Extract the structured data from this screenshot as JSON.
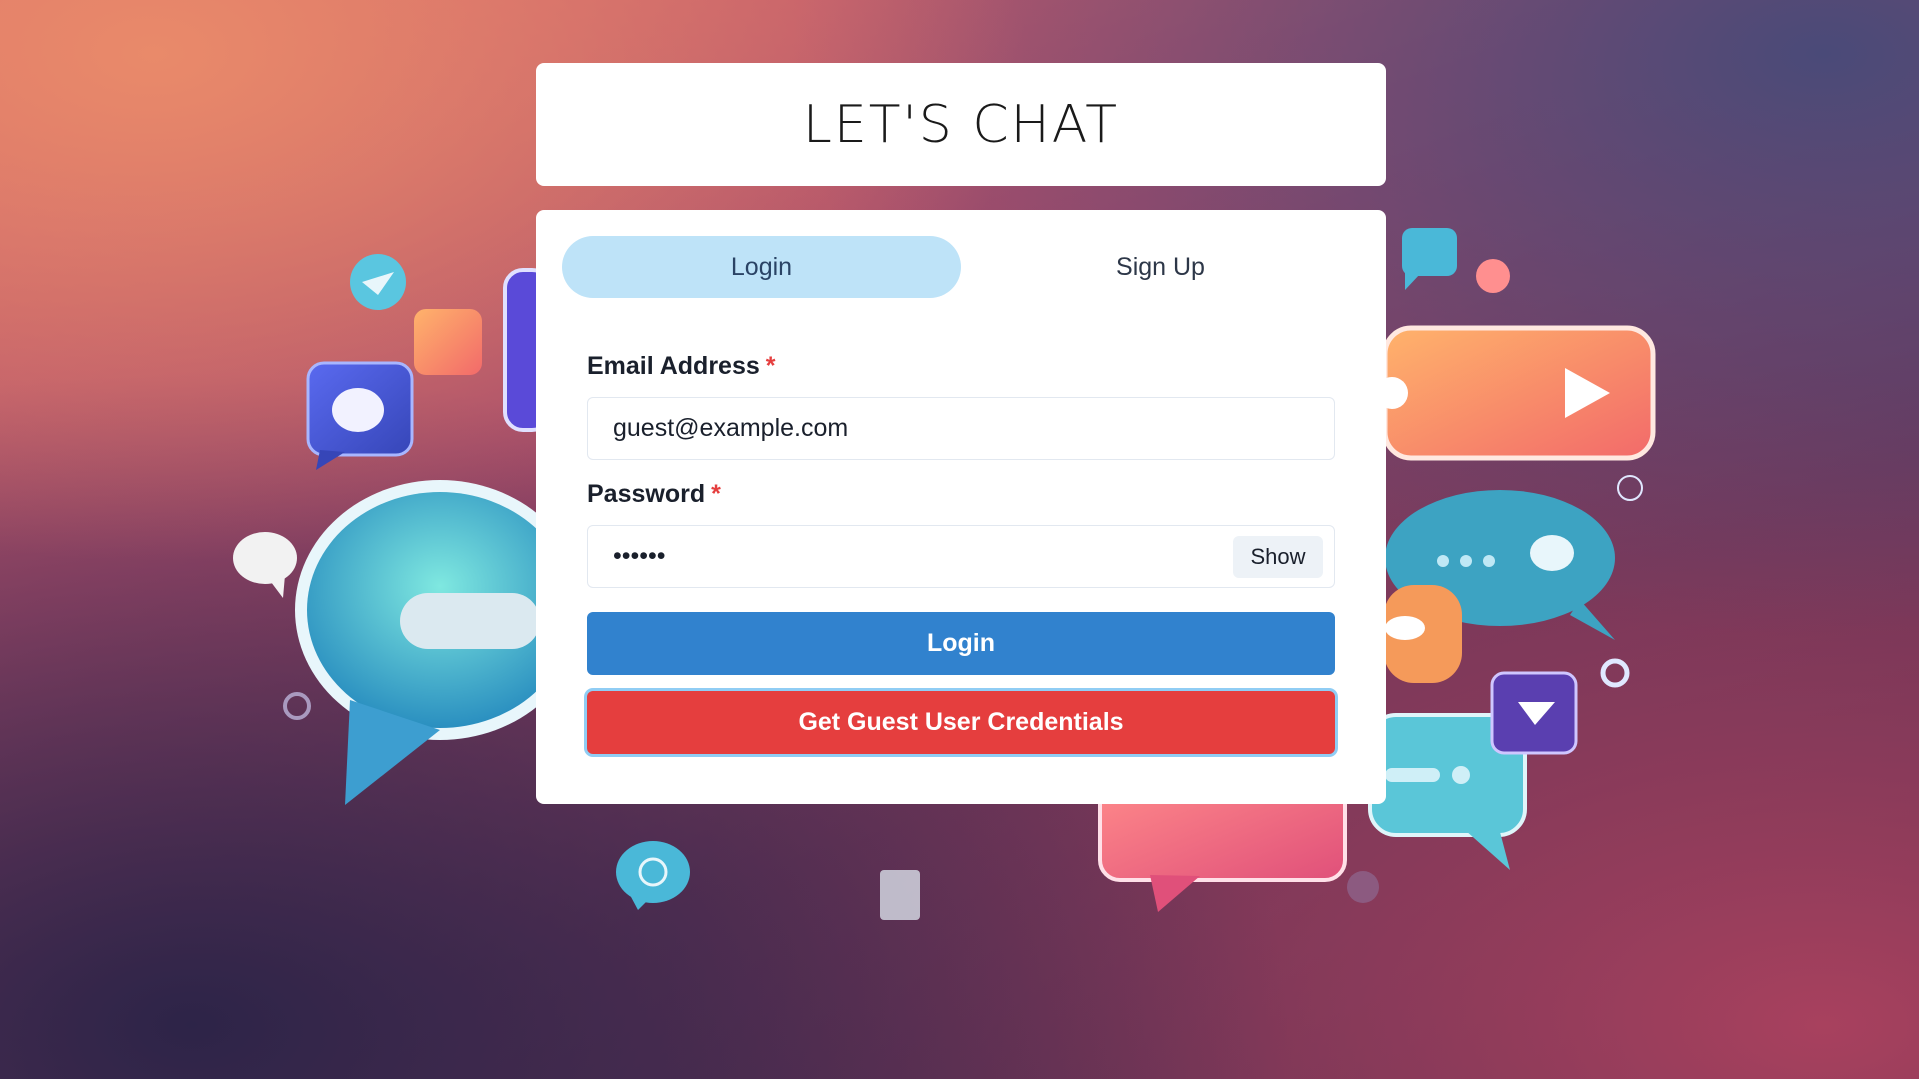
{
  "header": {
    "title": "LET'S CHAT"
  },
  "tabs": [
    {
      "label": "Login",
      "active": true
    },
    {
      "label": "Sign Up",
      "active": false
    }
  ],
  "form": {
    "email_label": "Email Address",
    "email_required_mark": "*",
    "email_value": "guest@example.com",
    "password_label": "Password",
    "password_required_mark": "*",
    "password_value": "123456",
    "show_label": "Show",
    "login_button": "Login",
    "guest_button": "Get Guest User Credentials"
  },
  "colors": {
    "tab_active_bg": "#bee3f8",
    "login_button": "#3182ce",
    "guest_button": "#e53e3e",
    "required_mark": "#e53e3e"
  },
  "background": {
    "icons": [
      "chat-bubble-icon",
      "play-icon",
      "cloud-icon",
      "send-icon",
      "image-icon",
      "ellipsis-icon"
    ]
  }
}
